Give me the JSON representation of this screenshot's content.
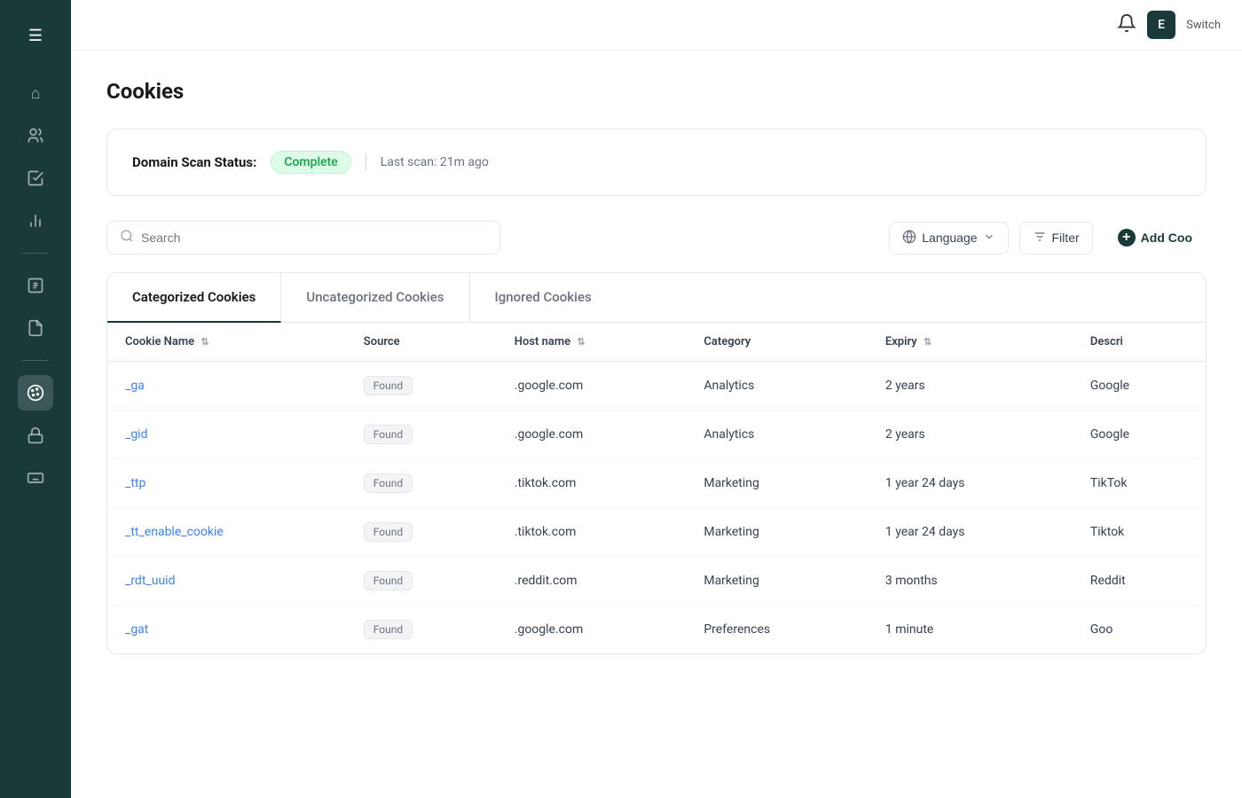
{
  "app": {
    "title": "Cookies",
    "user_initial": "E",
    "user_switch": "Switch"
  },
  "sidebar": {
    "hamburger": "☰",
    "items": [
      {
        "name": "home",
        "icon": "⌂",
        "active": false
      },
      {
        "name": "users",
        "icon": "👤",
        "active": false
      },
      {
        "name": "tasks",
        "icon": "✓≡",
        "active": false
      },
      {
        "name": "analytics",
        "icon": "📊",
        "active": false
      },
      {
        "name": "list",
        "icon": "☰",
        "active": false
      },
      {
        "name": "document",
        "icon": "📄",
        "active": false
      },
      {
        "name": "cookies",
        "icon": "🍪",
        "active": true
      },
      {
        "name": "lock",
        "icon": "🔒",
        "active": false
      },
      {
        "name": "keyboard",
        "icon": "⌨",
        "active": false
      }
    ]
  },
  "header": {
    "bell_icon": "🔔",
    "user_initial": "E",
    "user_label": "Switch"
  },
  "domain_scan": {
    "label": "Domain Scan Status:",
    "status": "Complete",
    "last_scan": "Last scan: 21m ago"
  },
  "toolbar": {
    "search_placeholder": "Search",
    "language_label": "Language",
    "filter_label": "Filter",
    "add_cookie_label": "Add Coo"
  },
  "tabs": [
    {
      "id": "categorized",
      "label": "Categorized Cookies",
      "active": true
    },
    {
      "id": "uncategorized",
      "label": "Uncategorized Cookies",
      "active": false
    },
    {
      "id": "ignored",
      "label": "Ignored Cookies",
      "active": false
    }
  ],
  "table": {
    "columns": [
      {
        "id": "name",
        "label": "Cookie Name",
        "sortable": true
      },
      {
        "id": "source",
        "label": "Source",
        "sortable": false
      },
      {
        "id": "hostname",
        "label": "Host name",
        "sortable": true
      },
      {
        "id": "category",
        "label": "Category",
        "sortable": false
      },
      {
        "id": "expiry",
        "label": "Expiry",
        "sortable": true
      },
      {
        "id": "description",
        "label": "Descri",
        "sortable": false
      }
    ],
    "rows": [
      {
        "name": "_ga",
        "source": "Found",
        "hostname": ".google.com",
        "category": "Analytics",
        "expiry": "2 years",
        "description": "Google"
      },
      {
        "name": "_gid",
        "source": "Found",
        "hostname": ".google.com",
        "category": "Analytics",
        "expiry": "2 years",
        "description": "Google"
      },
      {
        "name": "_ttp",
        "source": "Found",
        "hostname": ".tiktok.com",
        "category": "Marketing",
        "expiry": "1 year 24 days",
        "description": "TikTok"
      },
      {
        "name": "_tt_enable_cookie",
        "source": "Found",
        "hostname": ".tiktok.com",
        "category": "Marketing",
        "expiry": "1 year 24 days",
        "description": "Tiktok"
      },
      {
        "name": "_rdt_uuid",
        "source": "Found",
        "hostname": ".reddit.com",
        "category": "Marketing",
        "expiry": "3 months",
        "description": "Reddit"
      },
      {
        "name": "_gat",
        "source": "Found",
        "hostname": ".google.com",
        "category": "Preferences",
        "expiry": "1 minute",
        "description": "Goo"
      }
    ]
  }
}
